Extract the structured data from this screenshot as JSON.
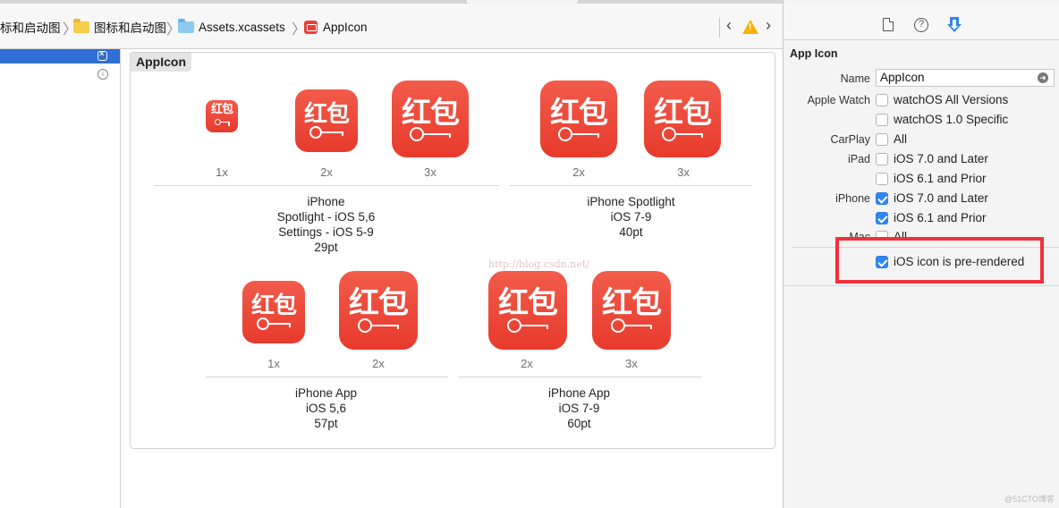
{
  "breadcrumbs": [
    {
      "label": "标和启动图",
      "icon": "folder-icon"
    },
    {
      "label": "图标和启动图",
      "icon": "folder-icon"
    },
    {
      "label": "Assets.xcassets",
      "icon": "folder-blue-icon"
    },
    {
      "label": "AppIcon",
      "icon": "appicon-file-icon"
    }
  ],
  "panel": {
    "title": "AppIcon",
    "icon_text": "红包",
    "groups": [
      {
        "lines": [
          "iPhone",
          "Spotlight - iOS 5,6",
          "Settings - iOS 5-9",
          "29pt"
        ],
        "scales": [
          "1x",
          "2x",
          "3x"
        ]
      },
      {
        "lines": [
          "iPhone Spotlight",
          "iOS 7-9",
          "40pt"
        ],
        "scales": [
          "2x",
          "3x"
        ]
      },
      {
        "lines": [
          "iPhone App",
          "iOS 5,6",
          "57pt"
        ],
        "scales": [
          "1x",
          "2x"
        ]
      },
      {
        "lines": [
          "iPhone App",
          "iOS 7-9",
          "60pt"
        ],
        "scales": [
          "2x",
          "3x"
        ]
      }
    ],
    "watermark": "http://blog.csdn.net/"
  },
  "inspector": {
    "title": "App Icon",
    "name_label": "Name",
    "name_value": "AppIcon",
    "apple_watch_label": "Apple Watch",
    "watch_all": "watchOS All Versions",
    "watch_10": "watchOS 1.0 Specific",
    "carplay_label": "CarPlay",
    "carplay_all": "All",
    "ipad_label": "iPad",
    "ipad_7": "iOS 7.0 and Later",
    "ipad_6": "iOS 6.1 and Prior",
    "iphone_label": "iPhone",
    "iphone_7": "iOS 7.0 and Later",
    "iphone_6": "iOS 6.1 and Prior",
    "mac_label": "Mac",
    "mac_all": "All",
    "prerendered": "iOS icon is pre-rendered",
    "checks": {
      "watch_all": false,
      "watch_10": false,
      "carplay_all": false,
      "ipad_7": false,
      "ipad_6": false,
      "iphone_7": true,
      "iphone_6": true,
      "mac_all": false,
      "prerendered": true
    }
  },
  "corner_watermark": "@51CTO博客",
  "colors": {
    "accent": "#2f86f2",
    "icon_red": "#e73a2d",
    "highlight": "#f0303a",
    "selection": "#2f6fd6"
  }
}
